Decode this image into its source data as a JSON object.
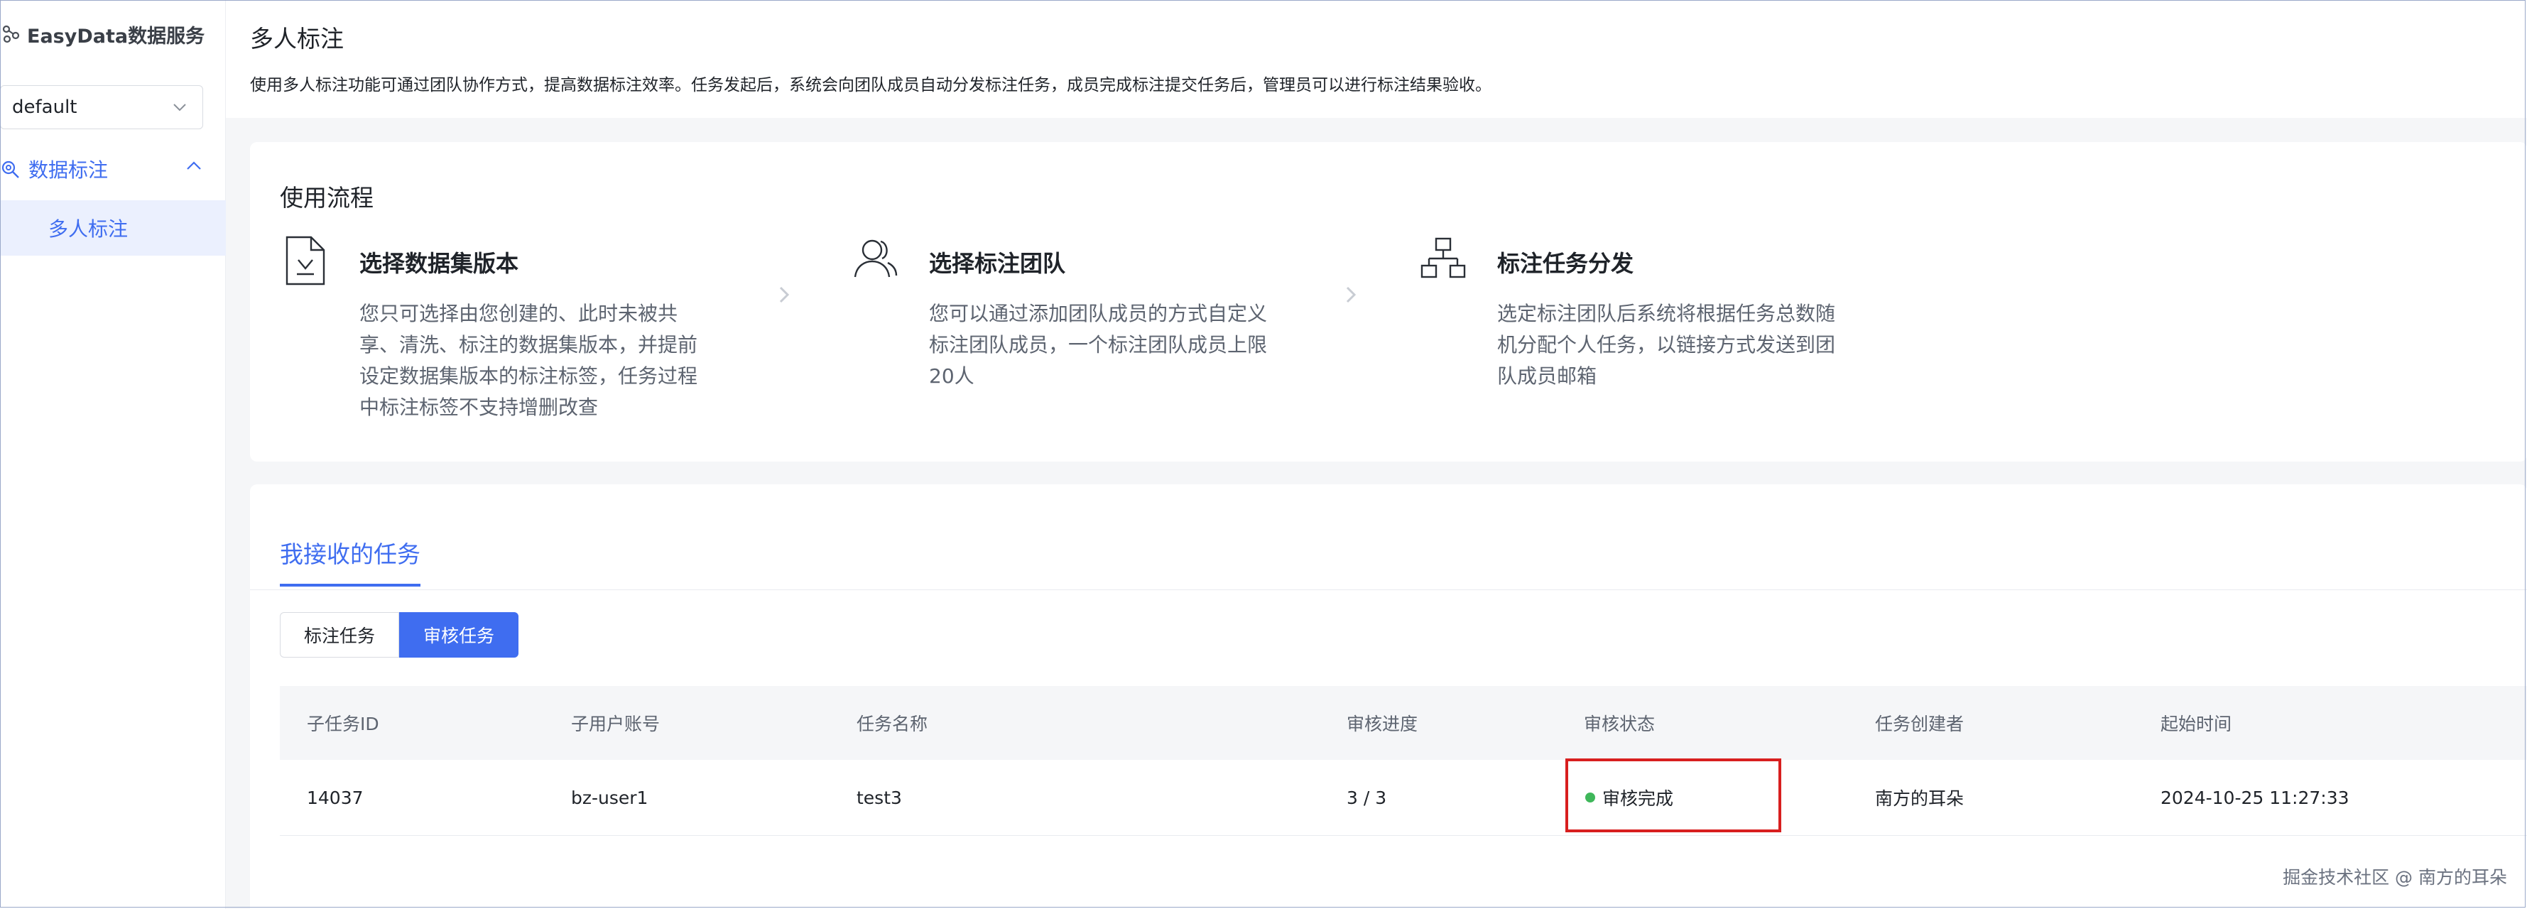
{
  "sidebar": {
    "brand": "EasyData数据服务",
    "workspace": "default",
    "group_label": "数据标注",
    "active_item": "多人标注"
  },
  "header": {
    "title": "多人标注",
    "description": "使用多人标注功能可通过团队协作方式，提高数据标注效率。任务发起后，系统会向团队成员自动分发标注任务，成员完成标注提交任务后，管理员可以进行标注结果验收。"
  },
  "flow": {
    "title": "使用流程",
    "steps": [
      {
        "icon": "document-check-icon",
        "title": "选择数据集版本",
        "text": "您只可选择由您创建的、此时未被共享、清洗、标注的数据集版本，并提前设定数据集版本的标注标签，任务过程中标注标签不支持增删改查"
      },
      {
        "icon": "users-icon",
        "title": "选择标注团队",
        "text": "您可以通过添加团队成员的方式自定义标注团队成员，一个标注团队成员上限20人"
      },
      {
        "icon": "hierarchy-icon",
        "title": "标注任务分发",
        "text": "选定标注团队后系统将根据任务总数随机分配个人任务，以链接方式发送到团队成员邮箱"
      }
    ]
  },
  "tasks": {
    "tab_label": "我接收的任务",
    "segments": [
      "标注任务",
      "审核任务"
    ],
    "columns": [
      "子任务ID",
      "子用户账号",
      "任务名称",
      "审核进度",
      "审核状态",
      "任务创建者",
      "起始时间"
    ],
    "rows": [
      [
        "14037",
        "bz-user1",
        "test3",
        "3 / 3",
        "审核完成",
        "南方的耳朵",
        "2024-10-25 11:27:33"
      ]
    ]
  },
  "watermark": "掘金技术社区 @ 南方的耳朵",
  "colors": {
    "accent": "#3f6df0",
    "status_done": "#3fb75a",
    "highlight": "#d81f1f"
  }
}
